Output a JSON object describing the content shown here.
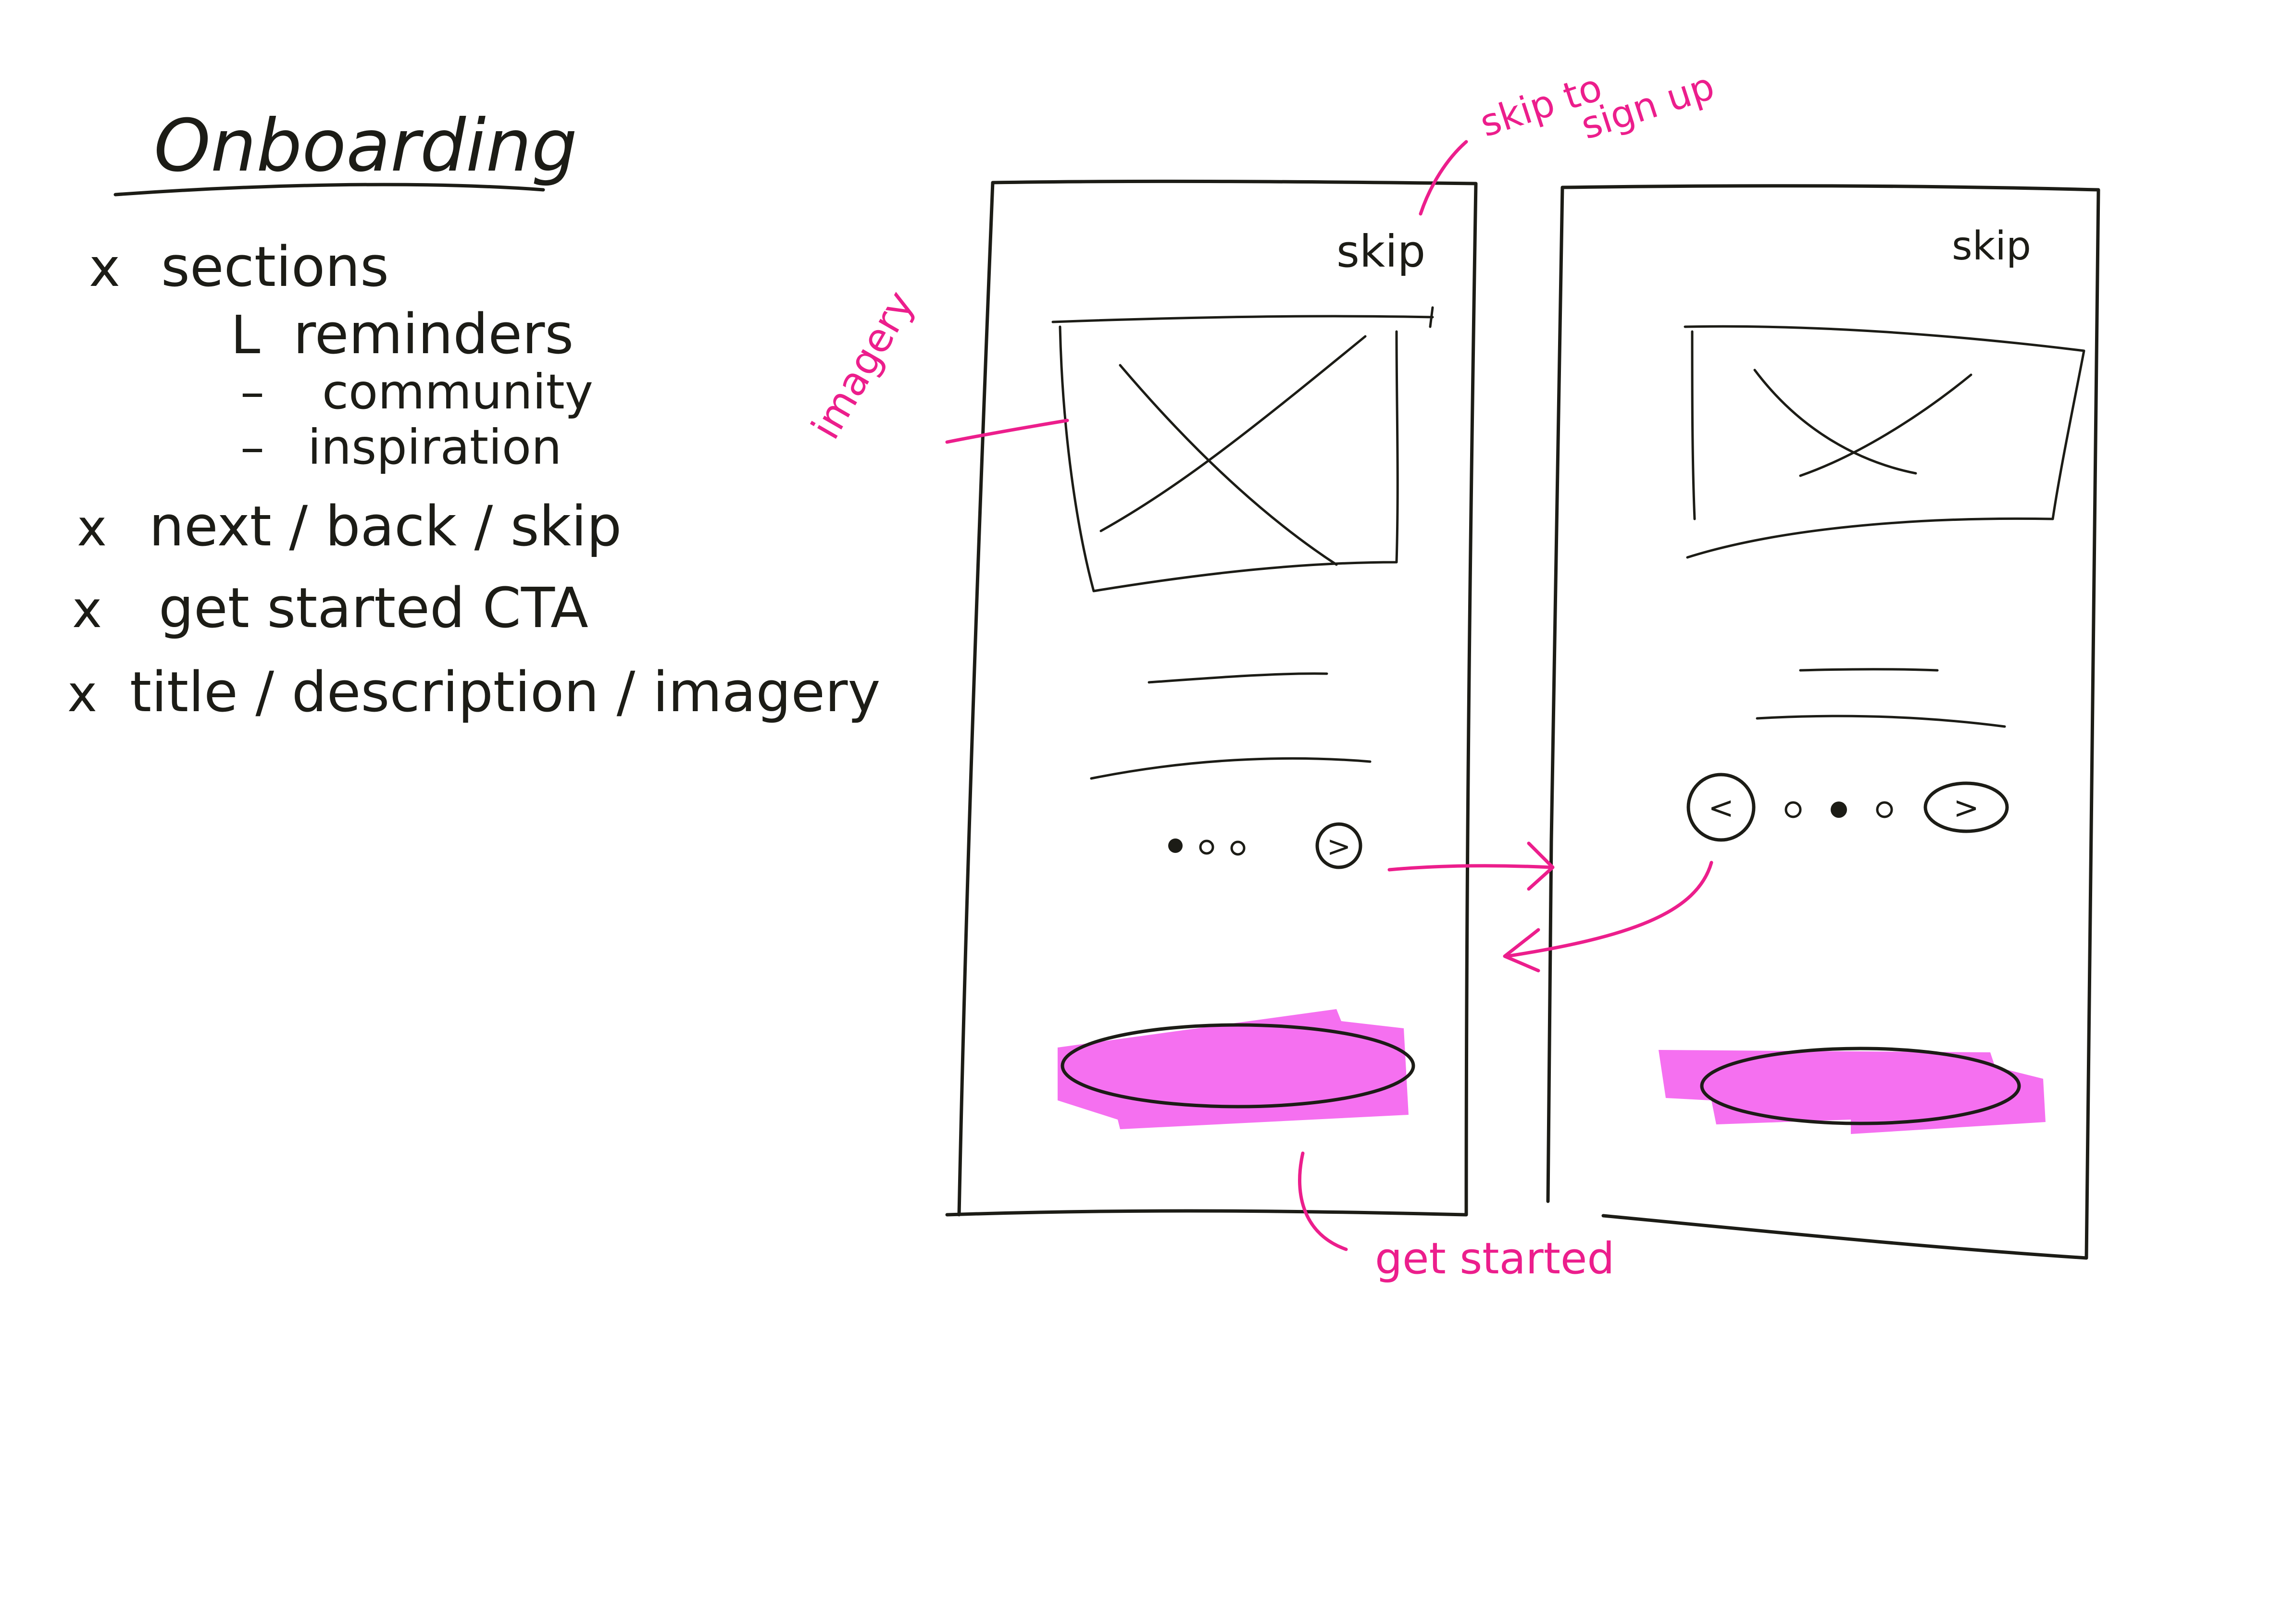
{
  "notes": {
    "title": "Onboarding",
    "items": [
      {
        "bullet": "x",
        "text": "sections"
      },
      {
        "bullet": "L",
        "text": "reminders"
      },
      {
        "bullet": "–",
        "text": "community"
      },
      {
        "bullet": "–",
        "text": "inspiration"
      },
      {
        "bullet": "x",
        "text": "next / back / skip"
      },
      {
        "bullet": "x",
        "text": "get started CTA"
      },
      {
        "bullet": "x",
        "text": "title / description / imagery"
      }
    ]
  },
  "annotations": {
    "skip_note_line1": "skip to",
    "skip_note_line2": "sign up",
    "imagery_note": "imagery",
    "cta_note": "get started"
  },
  "screen_one": {
    "skip_label": "skip",
    "next_glyph": ">",
    "page_dots": 3,
    "active_dot": 1
  },
  "screen_two": {
    "skip_label": "skip",
    "back_glyph": "<",
    "next_glyph": ">",
    "page_dots": 3,
    "active_dot": 2
  },
  "colors": {
    "ink": "#1c1c16",
    "annotation": "#ec1e8c",
    "cta_fill": "#f570f0"
  }
}
